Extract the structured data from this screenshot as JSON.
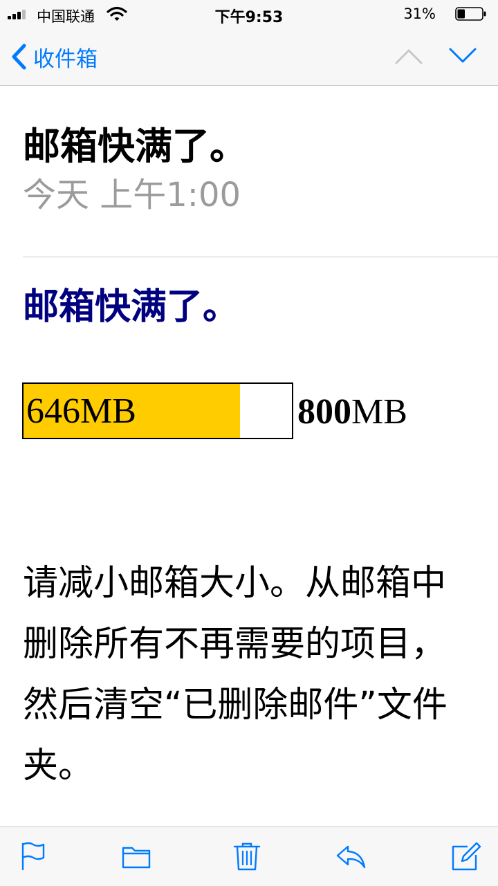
{
  "status_bar": {
    "carrier": "中国联通",
    "time": "下午9:53",
    "battery_percent": "31%",
    "battery_level": 0.31
  },
  "nav": {
    "back_label": "收件箱"
  },
  "message": {
    "subject": "邮箱快满了。",
    "datetime": "今天 上午1:00"
  },
  "body": {
    "title": "邮箱快满了。",
    "quota_used": "646MB",
    "quota_total_number": "800",
    "quota_total_unit": "MB",
    "quota_fraction": 0.8075,
    "text": "请减小邮箱大小。从邮箱中删除所有不再需要的项目，然后清空“已删除邮件”文件夹。"
  },
  "colors": {
    "accent": "#007aff",
    "title": "#000080",
    "quota_fill": "#ffcc00"
  }
}
